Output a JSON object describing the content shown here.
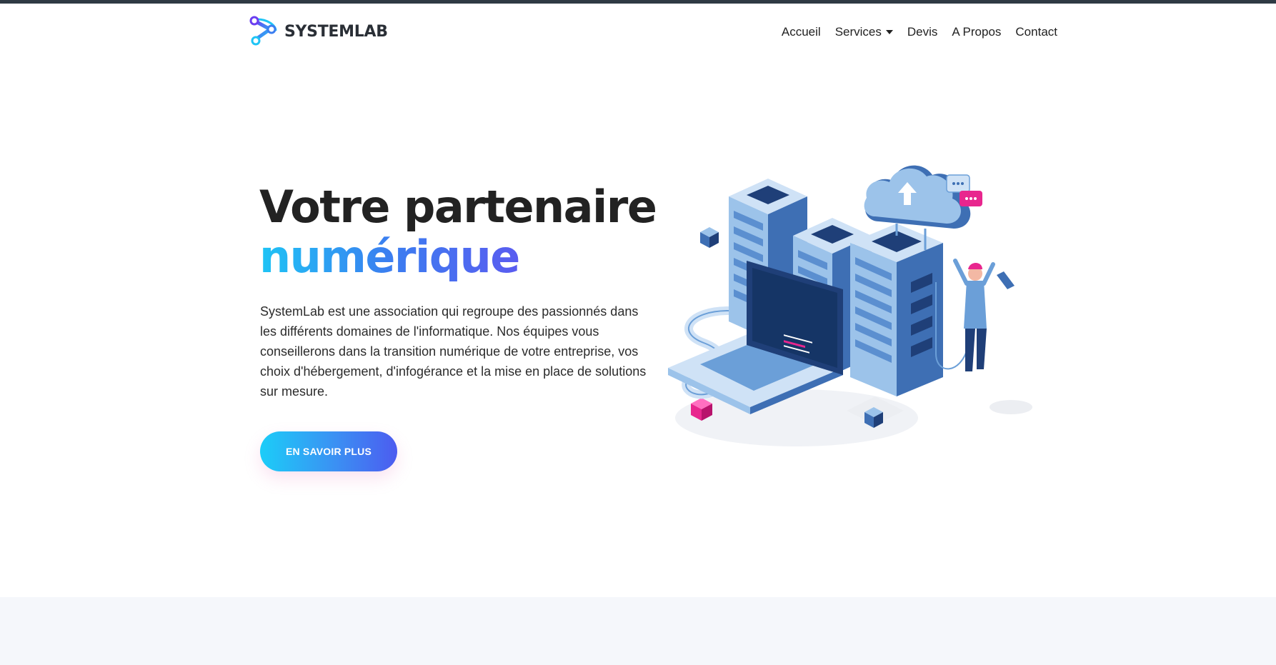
{
  "brand": {
    "name": "SYSTEMLAB",
    "logo_icon": "share-nodes-logo"
  },
  "nav": {
    "items": [
      {
        "label": "Accueil"
      },
      {
        "label": "Services",
        "has_dropdown": true
      },
      {
        "label": "Devis"
      },
      {
        "label": "A Propos"
      },
      {
        "label": "Contact"
      }
    ]
  },
  "hero": {
    "title_line1": "Votre partenaire",
    "title_line2": "numérique",
    "description": "SystemLab est une association qui regroupe des passionnés dans les différents domaines de l'informatique. Nos équipes vous conseillerons dans la transition numérique de votre entreprise, vos choix d'hébergement, d'infogérance et la mise en place de solutions sur mesure.",
    "cta_label": "EN SAVOIR PLUS",
    "illustration_icon": "server-cloud-illustration"
  },
  "colors": {
    "gradient_start": "#1ec4f5",
    "gradient_end": "#4c5cf0",
    "accent_pink": "#e8268e",
    "server_blue": "#3e6fb4"
  }
}
